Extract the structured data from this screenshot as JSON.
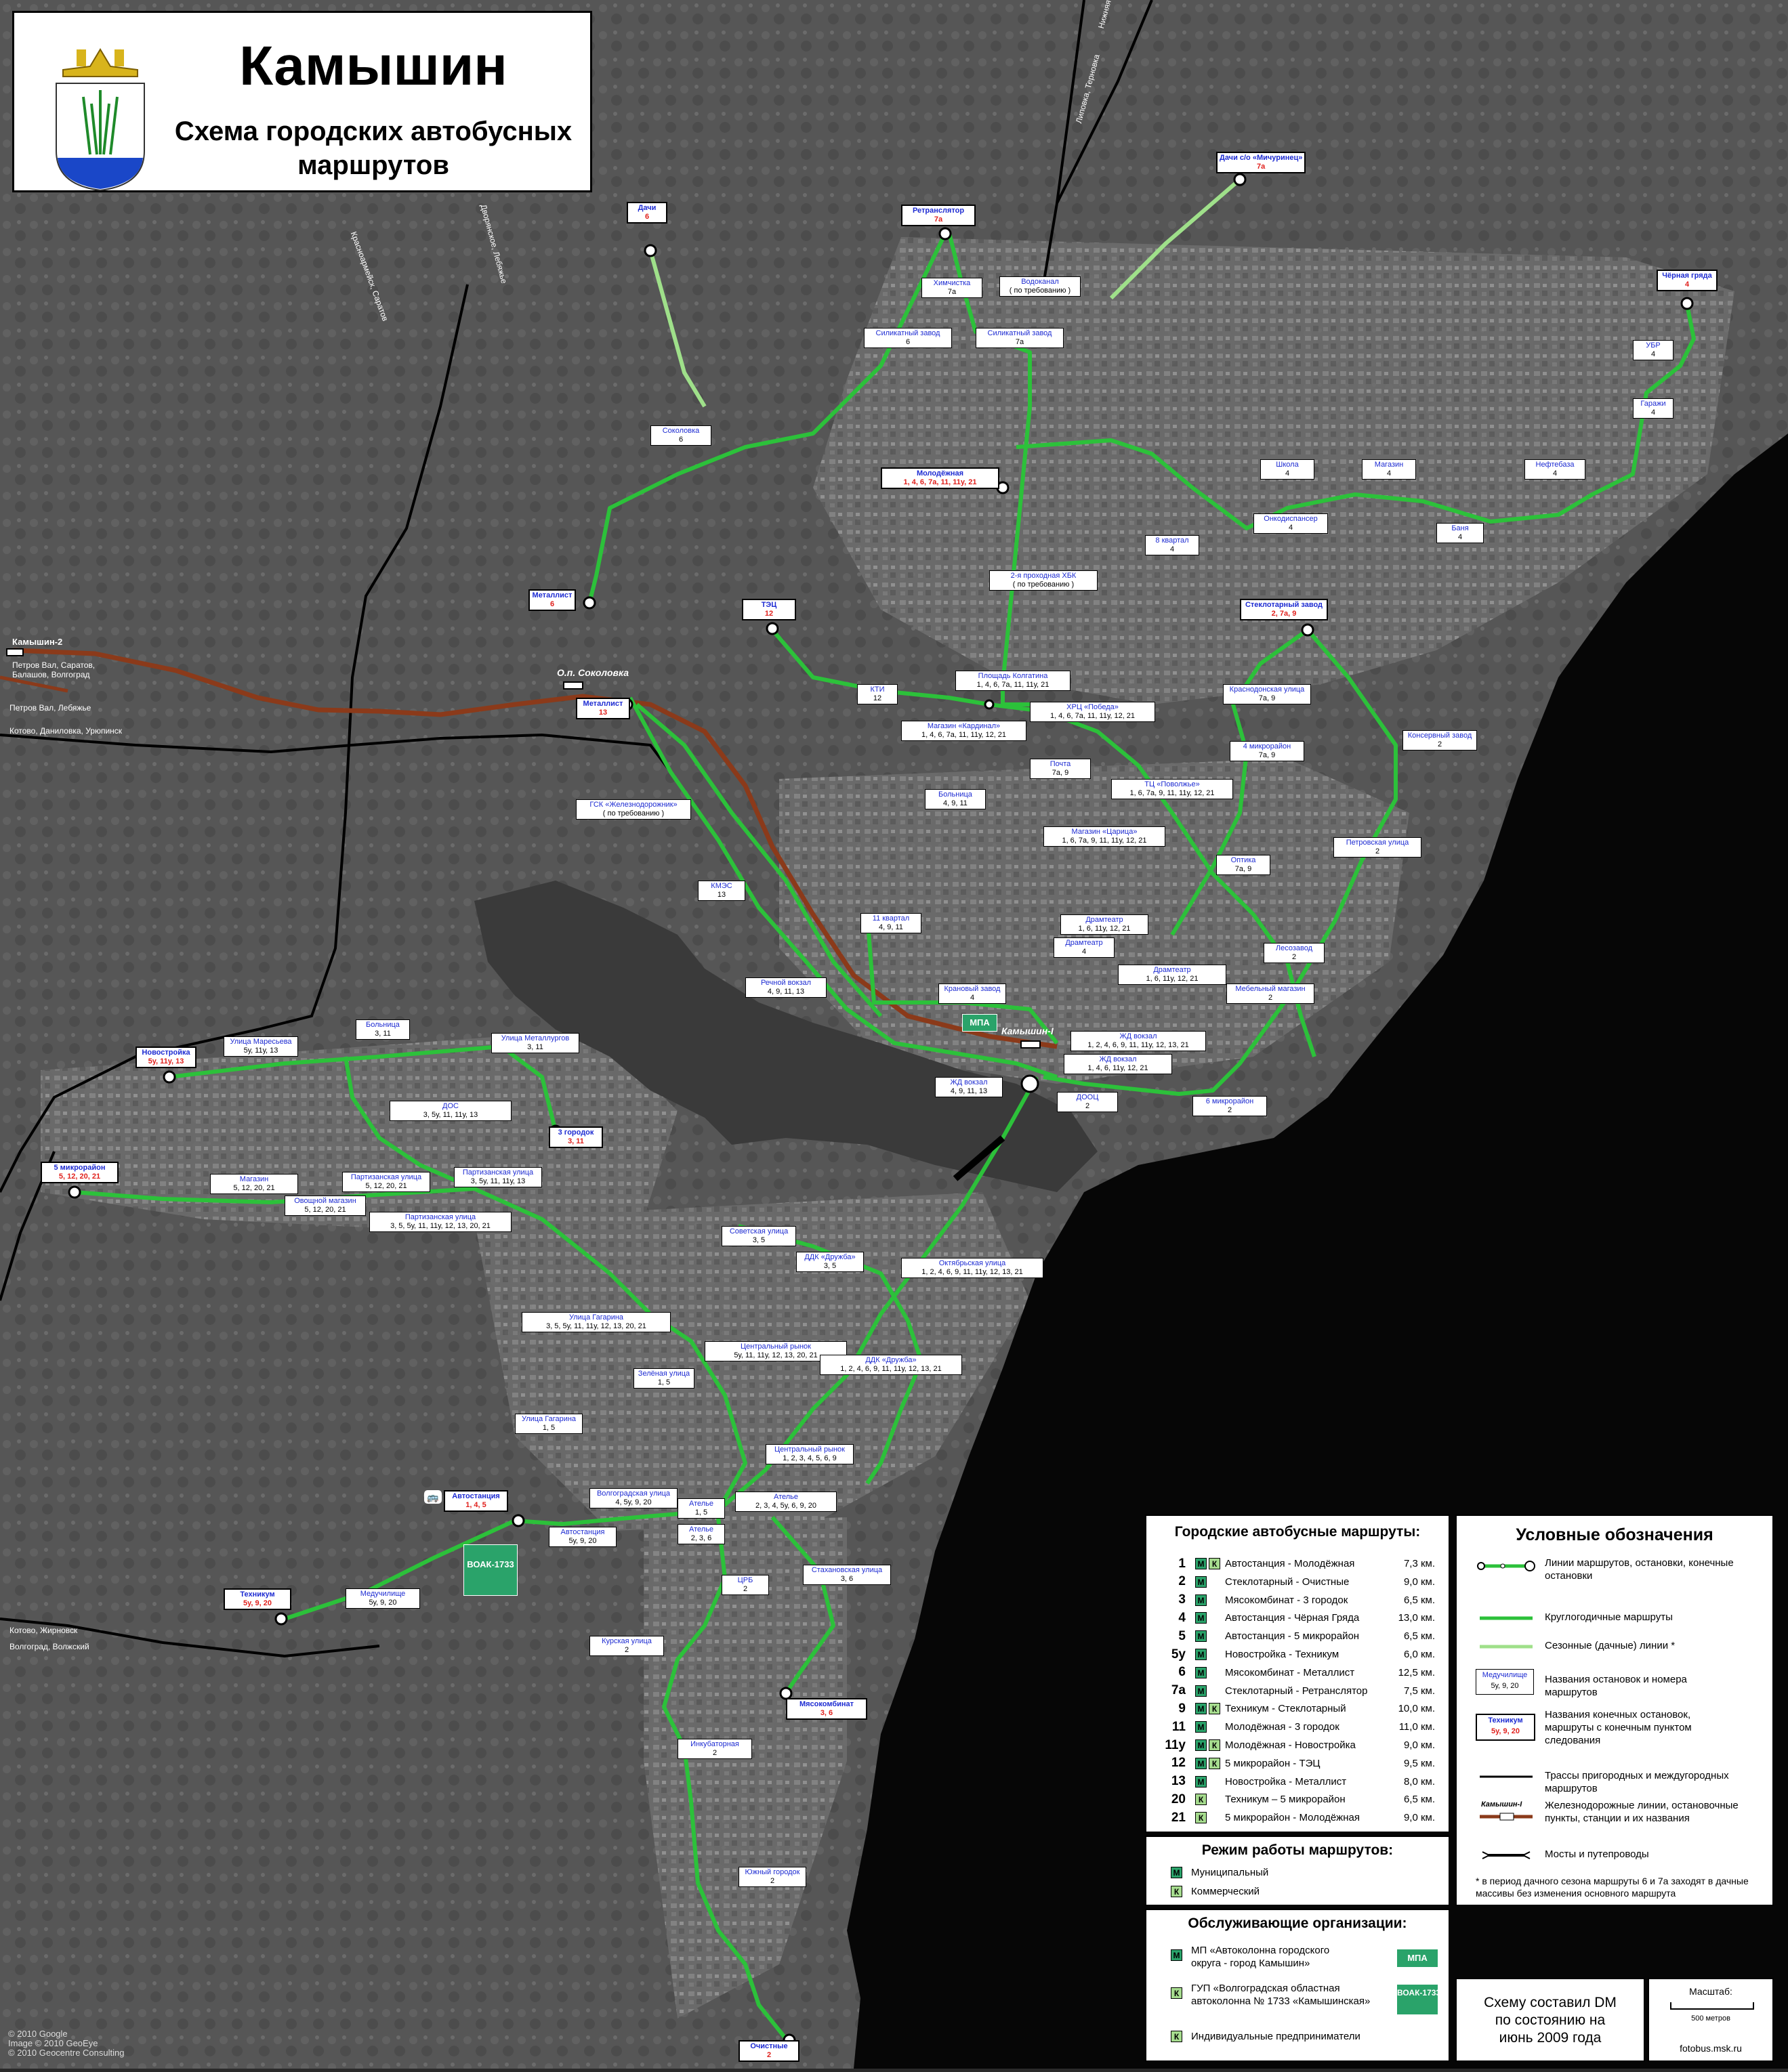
{
  "title": {
    "city": "Камышин",
    "subtitle_line1": "Схема городских автобусных",
    "subtitle_line2": "маршрутов"
  },
  "colors": {
    "route": "#2cc13a",
    "seasonal": "#9fe08a",
    "railway": "#8b3a1a",
    "suburban": "#000000",
    "water": "#050505",
    "municipal": "#2aa36a",
    "commercial": "#a6dc8e",
    "terminal_text": "#e0201c",
    "stop_name_text": "#1d2bd2"
  },
  "stops": [
    {
      "name": "Дачи",
      "routes": "6",
      "terminal": true
    },
    {
      "name": "Ретранслятор",
      "routes": "7а",
      "terminal": true
    },
    {
      "name": "Дачи с/о «Мичуринец»",
      "routes": "7а",
      "terminal": true
    },
    {
      "name": "Химчистка",
      "routes": "7а"
    },
    {
      "name": "Водоканал",
      "routes": "( по требованию )"
    },
    {
      "name": "Силикатный завод",
      "routes": "6"
    },
    {
      "name": "Силикатный завод",
      "routes": "7а"
    },
    {
      "name": "Чёрная гряда",
      "routes": "4",
      "terminal": true
    },
    {
      "name": "УБР",
      "routes": "4"
    },
    {
      "name": "Гаражи",
      "routes": "4"
    },
    {
      "name": "Соколовка",
      "routes": "6"
    },
    {
      "name": "Молодёжная",
      "routes": "1, 4, 6, 7а, 11, 11у, 21",
      "terminal": true
    },
    {
      "name": "Школа",
      "routes": "4"
    },
    {
      "name": "Магазин",
      "routes": "4"
    },
    {
      "name": "Нефтебаза",
      "routes": "4"
    },
    {
      "name": "Онкодиспансер",
      "routes": "4"
    },
    {
      "name": "Баня",
      "routes": "4"
    },
    {
      "name": "8 квартал",
      "routes": "4"
    },
    {
      "name": "2-я проходная ХБК",
      "routes": "( по требованию )"
    },
    {
      "name": "Металлист",
      "routes": "6",
      "terminal": true
    },
    {
      "name": "ТЭЦ",
      "routes": "12",
      "terminal": true
    },
    {
      "name": "Стеклотарный завод",
      "routes": "2, 7а, 9",
      "terminal": true
    },
    {
      "name": "Площадь Колгатина",
      "routes": "1, 4, 6, 7а, 11, 11у, 21"
    },
    {
      "name": "КТИ",
      "routes": "12"
    },
    {
      "name": "Краснодонская улица",
      "routes": "7а, 9"
    },
    {
      "name": "Магазин «Кардинал»",
      "routes": "1, 4, 6, 7а, 11, 11у, 12, 21"
    },
    {
      "name": "ХРЦ «Победа»",
      "routes": "1, 4, 6, 7а, 11, 11у, 12, 21"
    },
    {
      "name": "Консервный завод",
      "routes": "2"
    },
    {
      "name": "Металлист",
      "routes": "13",
      "terminal": true
    },
    {
      "name": "Почта",
      "routes": "7а, 9"
    },
    {
      "name": "4 микрорайон",
      "routes": "7а, 9"
    },
    {
      "name": "ТЦ «Поволжье»",
      "routes": "1, 6, 7а, 9, 11, 11у, 12, 21"
    },
    {
      "name": "Больница",
      "routes": "4, 9, 11"
    },
    {
      "name": "ГСК «Железнодорожник»",
      "routes": "( по требованию )"
    },
    {
      "name": "Магазин «Царица»",
      "routes": "1, 6, 7а, 9, 11, 11у, 12, 21"
    },
    {
      "name": "Петровская улица",
      "routes": "2"
    },
    {
      "name": "Оптика",
      "routes": "7а, 9"
    },
    {
      "name": "КМЭС",
      "routes": "13"
    },
    {
      "name": "11 квартал",
      "routes": "4, 9, 11"
    },
    {
      "name": "Драмтеатр",
      "routes": "1, 6, 11у, 12, 21"
    },
    {
      "name": "Драмтеатр",
      "routes": "4"
    },
    {
      "name": "Лесозавод",
      "routes": "2"
    },
    {
      "name": "Драмтеатр",
      "routes": "1, 6, 11у, 12, 21"
    },
    {
      "name": "Речной вокзал",
      "routes": "4, 9, 11, 13"
    },
    {
      "name": "Крановый завод",
      "routes": "4"
    },
    {
      "name": "Мебельный магазин",
      "routes": "2"
    },
    {
      "name": "ЖД вокзал",
      "routes": "1, 2, 4, 6, 9, 11, 11у, 12, 13, 21"
    },
    {
      "name": "ЖД вокзал",
      "routes": "1, 4, 6, 11у, 12, 21"
    },
    {
      "name": "ЖД вокзал",
      "routes": "4, 9, 11, 13"
    },
    {
      "name": "ДООЦ",
      "routes": "2"
    },
    {
      "name": "6 микрорайон",
      "routes": "2"
    },
    {
      "name": "Новостройка",
      "routes": "5у, 11у, 13",
      "terminal": true
    },
    {
      "name": "Улица Маресьева",
      "routes": "5у, 11у, 13"
    },
    {
      "name": "Больница",
      "routes": "3, 11"
    },
    {
      "name": "Улица Металлургов",
      "routes": "3, 11"
    },
    {
      "name": "ДОС",
      "routes": "3, 5у, 11, 11у, 13"
    },
    {
      "name": "3 городок",
      "routes": "3, 11",
      "terminal": true
    },
    {
      "name": "5 микрорайон",
      "routes": "5, 12, 20, 21",
      "terminal": true
    },
    {
      "name": "Магазин",
      "routes": "5, 12, 20, 21"
    },
    {
      "name": "Партизанская улица",
      "routes": "5, 12, 20, 21"
    },
    {
      "name": "Партизанская улица",
      "routes": "3, 5у, 11, 11у, 13"
    },
    {
      "name": "Овощной магазин",
      "routes": "5, 12, 20, 21"
    },
    {
      "name": "Партизанская улица",
      "routes": "3, 5, 5у, 11, 11у, 12, 13, 20, 21"
    },
    {
      "name": "Советская улица",
      "routes": "3, 5"
    },
    {
      "name": "ДДК «Дружба»",
      "routes": "3, 5"
    },
    {
      "name": "Октябрьская улица",
      "routes": "1, 2, 4, 6, 9, 11, 11у, 12, 13, 21"
    },
    {
      "name": "Улица Гагарина",
      "routes": "3, 5, 5у, 11, 11у, 12, 13, 20, 21"
    },
    {
      "name": "Центральный рынок",
      "routes": "5у, 11, 11у, 12, 13, 20, 21"
    },
    {
      "name": "ДДК «Дружба»",
      "routes": "1, 2, 4, 6, 9, 11, 11у, 12, 13, 21"
    },
    {
      "name": "Зелёная улица",
      "routes": "1, 5"
    },
    {
      "name": "Улица Гагарина",
      "routes": "1, 5"
    },
    {
      "name": "Центральный рынок",
      "routes": "1, 2, 3, 4, 5, 6, 9"
    },
    {
      "name": "Ателье",
      "routes": "1, 5"
    },
    {
      "name": "Автостанция",
      "routes": "1, 4, 5",
      "terminal": true
    },
    {
      "name": "Волгоградская улица",
      "routes": "4, 5у, 9, 20"
    },
    {
      "name": "Ателье",
      "routes": "2, 3, 4, 5у, 6, 9, 20"
    },
    {
      "name": "Автостанция",
      "routes": "5у, 9, 20"
    },
    {
      "name": "Ателье",
      "routes": "2, 3, 6"
    },
    {
      "name": "ЦРБ",
      "routes": "2"
    },
    {
      "name": "Стахановская улица",
      "routes": "3, 6"
    },
    {
      "name": "Техникум",
      "routes": "5у, 9, 20",
      "terminal": true
    },
    {
      "name": "Медучилище",
      "routes": "5у, 9, 20"
    },
    {
      "name": "Курская улица",
      "routes": "2"
    },
    {
      "name": "Мясокомбинат",
      "routes": "3, 6",
      "terminal": true
    },
    {
      "name": "Инкубаторная",
      "routes": "2"
    },
    {
      "name": "Южный городок",
      "routes": "2"
    },
    {
      "name": "Очистные",
      "routes": "2",
      "terminal": true
    }
  ],
  "map_text": {
    "rail_station_1": "О.п. Соколовка",
    "rail_station_2": "Камышин-I",
    "rail_station_3": "Камышин-2",
    "dir_kamyshin2": "Петров Вал, Саратов, Балашов, Волгоград",
    "dir_lebyazhye": "Петров Вал, Лебяжье",
    "dir_kotovo": "Котово, Даниловка, Урюпинск",
    "dir_zhirnovsk": "Котово, Жирновск",
    "dir_volgograd": "Волгоград, Волжский",
    "dir_nizh_dobrinka": "Нижняя Добринка",
    "dir_lipovka": "Липовка, Терновка",
    "dir_top_left": "Красноармейск, Саратов",
    "dir_top_mid": "Дворянское, Лебяжье",
    "mpa_label": "МПА",
    "voak_label": "ВОАК-1733"
  },
  "routes_panel": {
    "title": "Городские автобусные маршруты:",
    "routes": [
      {
        "num": "1",
        "m": true,
        "k": true,
        "desc": "Автостанция - Молодёжная",
        "km": "7,3 км."
      },
      {
        "num": "2",
        "m": true,
        "k": false,
        "desc": "Стеклотарный - Очистные",
        "km": "9,0 км."
      },
      {
        "num": "3",
        "m": true,
        "k": false,
        "desc": "Мясокомбинат - 3 городок",
        "km": "6,5 км."
      },
      {
        "num": "4",
        "m": true,
        "k": false,
        "desc": "Автостанция - Чёрная Гряда",
        "km": "13,0 км."
      },
      {
        "num": "5",
        "m": true,
        "k": false,
        "desc": "Автостанция - 5 микрорайон",
        "km": "6,5 км."
      },
      {
        "num": "5у",
        "m": true,
        "k": false,
        "desc": "Новостройка - Техникум",
        "km": "6,0 км."
      },
      {
        "num": "6",
        "m": true,
        "k": false,
        "desc": "Мясокомбинат - Металлист",
        "km": "12,5 км."
      },
      {
        "num": "7а",
        "m": true,
        "k": false,
        "desc": "Стеклотарный - Ретранслятор",
        "km": "7,5 км."
      },
      {
        "num": "9",
        "m": true,
        "k": true,
        "desc": "Техникум - Стеклотарный",
        "km": "10,0 км."
      },
      {
        "num": "11",
        "m": true,
        "k": false,
        "desc": "Молодёжная - 3 городок",
        "km": "11,0 км."
      },
      {
        "num": "11у",
        "m": true,
        "k": true,
        "desc": "Молодёжная - Новостройка",
        "km": "9,0 км."
      },
      {
        "num": "12",
        "m": true,
        "k": true,
        "desc": "5 микрорайон - ТЭЦ",
        "km": "9,5 км."
      },
      {
        "num": "13",
        "m": true,
        "k": false,
        "desc": "Новостройка - Металлист",
        "km": "8,0 км."
      },
      {
        "num": "20",
        "m": false,
        "k": true,
        "desc": "Техникум – 5 микрорайон",
        "km": "6,5 км."
      },
      {
        "num": "21",
        "m": false,
        "k": true,
        "desc": "5 микрорайон - Молодёжная",
        "km": "9,0 км."
      }
    ]
  },
  "mode_panel": {
    "title": "Режим работы маршрутов:",
    "m_badge": "М",
    "k_badge": "К",
    "municipal": "Муниципальный",
    "commercial": "Коммерческий"
  },
  "orgs_panel": {
    "title": "Обслуживающие организации:",
    "org1": "МП «Автоколонна городского округа - город Камышин»",
    "org1_badge": "МПА",
    "org2": "ГУП «Волгоградская областная автоколонна № 1733 «Камышинская»",
    "org2_badge": "ВОАК-1733",
    "org3": "Индивидуальные предприниматели"
  },
  "legend": {
    "title": "Условные обозначения",
    "item1": "Линии маршрутов, остановки, конечные остановки",
    "item2": "Круглогодичные маршруты",
    "item3": "Сезонные (дачные) линии *",
    "item4": "Названия остановок и номера маршрутов",
    "item4_sample_name": "Медучилище",
    "item4_sample_routes": "5у, 9, 20",
    "item5": "Названия конечных остановок, маршруты с конечным пунктом следования",
    "item5_sample_name": "Техникум",
    "item5_sample_routes": "5у, 9, 20",
    "item6": "Трассы пригородных и междугородных маршрутов",
    "item7": "Железнодорожные линии, остановочные пункты, станции и их названия",
    "item7_sample": "Камышин-I",
    "item8": "Мосты и путепроводы",
    "note": "* в период дачного сезона маршруты 6 и 7а заходят в дачные массивы без изменения основного маршрута"
  },
  "author": {
    "line1": "Схему составил DM",
    "line2": "по состоянию на",
    "line3": "июнь 2009 года"
  },
  "scale": {
    "title": "Масштаб:",
    "label": "500 метров",
    "site": "fotobus.msk.ru"
  },
  "copyright": {
    "line1": "© 2010 Google",
    "line2": "Image © 2010 GeoEye",
    "line3": "© 2010 Geocentre Consulting"
  }
}
